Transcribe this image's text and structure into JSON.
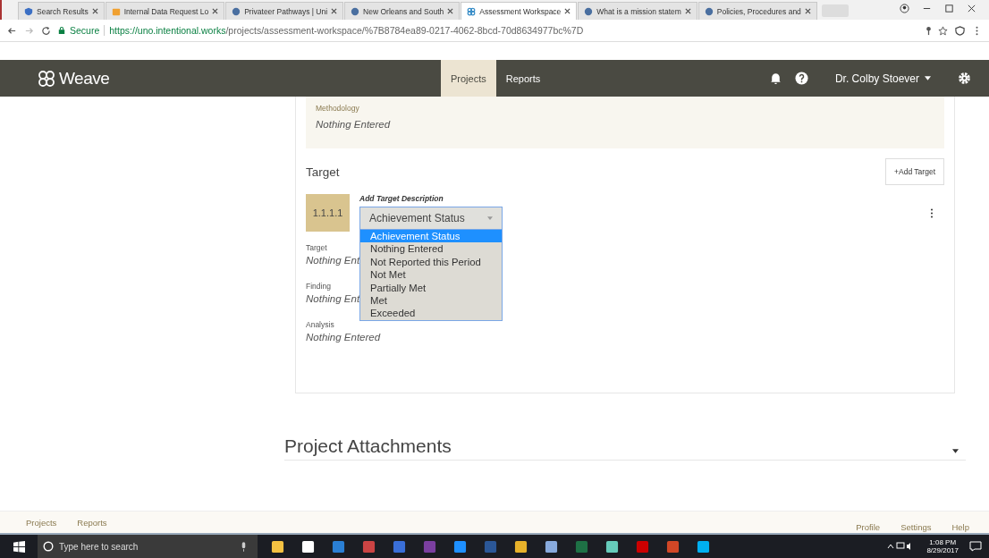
{
  "browser": {
    "tabs": [
      {
        "title": "Search Results",
        "selected": false,
        "kind": "shield"
      },
      {
        "title": "Internal Data Request Lo",
        "selected": false,
        "kind": "folder"
      },
      {
        "title": "Privateer Pathways | Uni",
        "selected": false,
        "kind": "globe"
      },
      {
        "title": "New Orleans and South",
        "selected": false,
        "kind": "globe"
      },
      {
        "title": "Assessment Workspace",
        "selected": true,
        "kind": "weave"
      },
      {
        "title": "What is a mission statem",
        "selected": false,
        "kind": "globe"
      },
      {
        "title": "Policies, Procedures and",
        "selected": false,
        "kind": "globe"
      }
    ],
    "secure_label": "Secure",
    "url_host": "https://uno.intentional.works",
    "url_path": "/projects/assessment-workspace/%7B8784ea89-0217-4062-8bcd-70d8634977bc%7D"
  },
  "app": {
    "logo": "Weave",
    "nav": [
      {
        "label": "Projects",
        "selected": true
      },
      {
        "label": "Reports",
        "selected": false
      }
    ],
    "user": "Dr. Colby Stoever"
  },
  "methodology": {
    "label": "Methodology",
    "value": "Nothing Entered"
  },
  "target_section": {
    "heading": "Target",
    "add_button": "+Add Target",
    "code": "1.1.1.1",
    "description_label": "Add Target Description",
    "select": {
      "value": "Achievement Status",
      "expanded": true,
      "options": [
        {
          "label": "Achievement Status",
          "selected": true
        },
        {
          "label": "Nothing Entered",
          "selected": false
        },
        {
          "label": "Not Reported this Period",
          "selected": false
        },
        {
          "label": "Not Met",
          "selected": false
        },
        {
          "label": "Partially Met",
          "selected": false
        },
        {
          "label": "Met",
          "selected": false
        },
        {
          "label": "Exceeded",
          "selected": false
        }
      ]
    },
    "fields": [
      {
        "label": "Target",
        "value": "Nothing Ent"
      },
      {
        "label": "Finding",
        "value": "Nothing Ent"
      },
      {
        "label": "Analysis",
        "value": "Nothing Entered"
      }
    ]
  },
  "attachments": {
    "heading": "Project Attachments"
  },
  "footer": {
    "left": [
      "Projects",
      "Reports"
    ],
    "right": [
      "Profile",
      "Settings",
      "Help"
    ]
  },
  "taskbar": {
    "search_placeholder": "Type here to search",
    "time": "1:08 PM",
    "date": "8/29/2017"
  }
}
